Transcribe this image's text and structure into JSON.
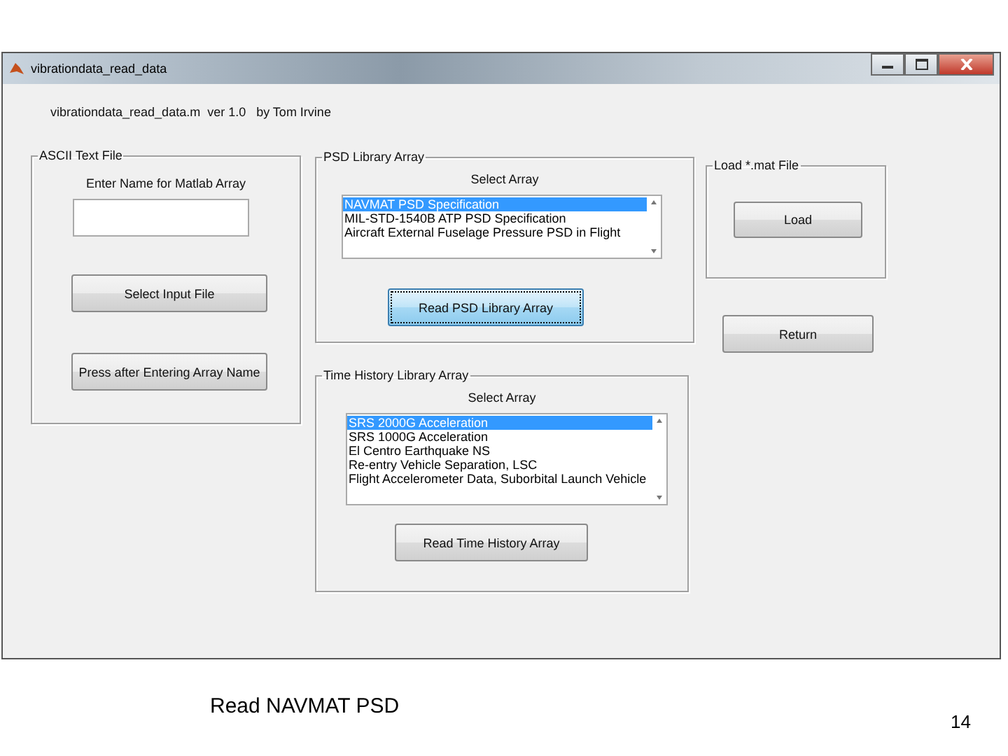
{
  "window": {
    "title": "vibrationdata_read_data"
  },
  "header": "vibrationdata_read_data.m  ver 1.0   by Tom Irvine",
  "ascii_panel": {
    "title": "ASCII Text File",
    "field_label": "Enter Name for Matlab Array",
    "buttons": [
      {
        "label": "Select Input File",
        "focused": false
      },
      {
        "label": "Press after Entering Array Name",
        "focused": false
      }
    ]
  },
  "psd_panel": {
    "title": "PSD Library Array",
    "list_label": "Select Array",
    "items": [
      {
        "label": "NAVMAT PSD Specification",
        "selected": true
      },
      {
        "label": "MIL-STD-1540B ATP PSD Specification",
        "selected": false
      },
      {
        "label": "Aircraft External Fuselage Pressure PSD in Flight",
        "selected": false
      }
    ],
    "button": {
      "label": "Read PSD Library Array",
      "focused": true
    }
  },
  "time_history_panel": {
    "title": "Time History Library Array",
    "list_label": "Select Array",
    "items": [
      {
        "label": "SRS 2000G Acceleration",
        "selected": true
      },
      {
        "label": "SRS 1000G Acceleration",
        "selected": false
      },
      {
        "label": "El Centro Earthquake NS",
        "selected": false
      },
      {
        "label": "Re-entry Vehicle Separation, LSC",
        "selected": false
      },
      {
        "label": "Flight Accelerometer Data, Suborbital Launch Vehicle",
        "selected": false
      }
    ],
    "button": {
      "label": "Read Time History Array",
      "focused": false
    }
  },
  "load_panel": {
    "title": "Load *.mat File",
    "button": {
      "label": "Load",
      "focused": false
    }
  },
  "return_button": {
    "label": "Return",
    "focused": false
  },
  "slide": {
    "caption": "Read NAVMAT PSD",
    "page_number": "14"
  }
}
